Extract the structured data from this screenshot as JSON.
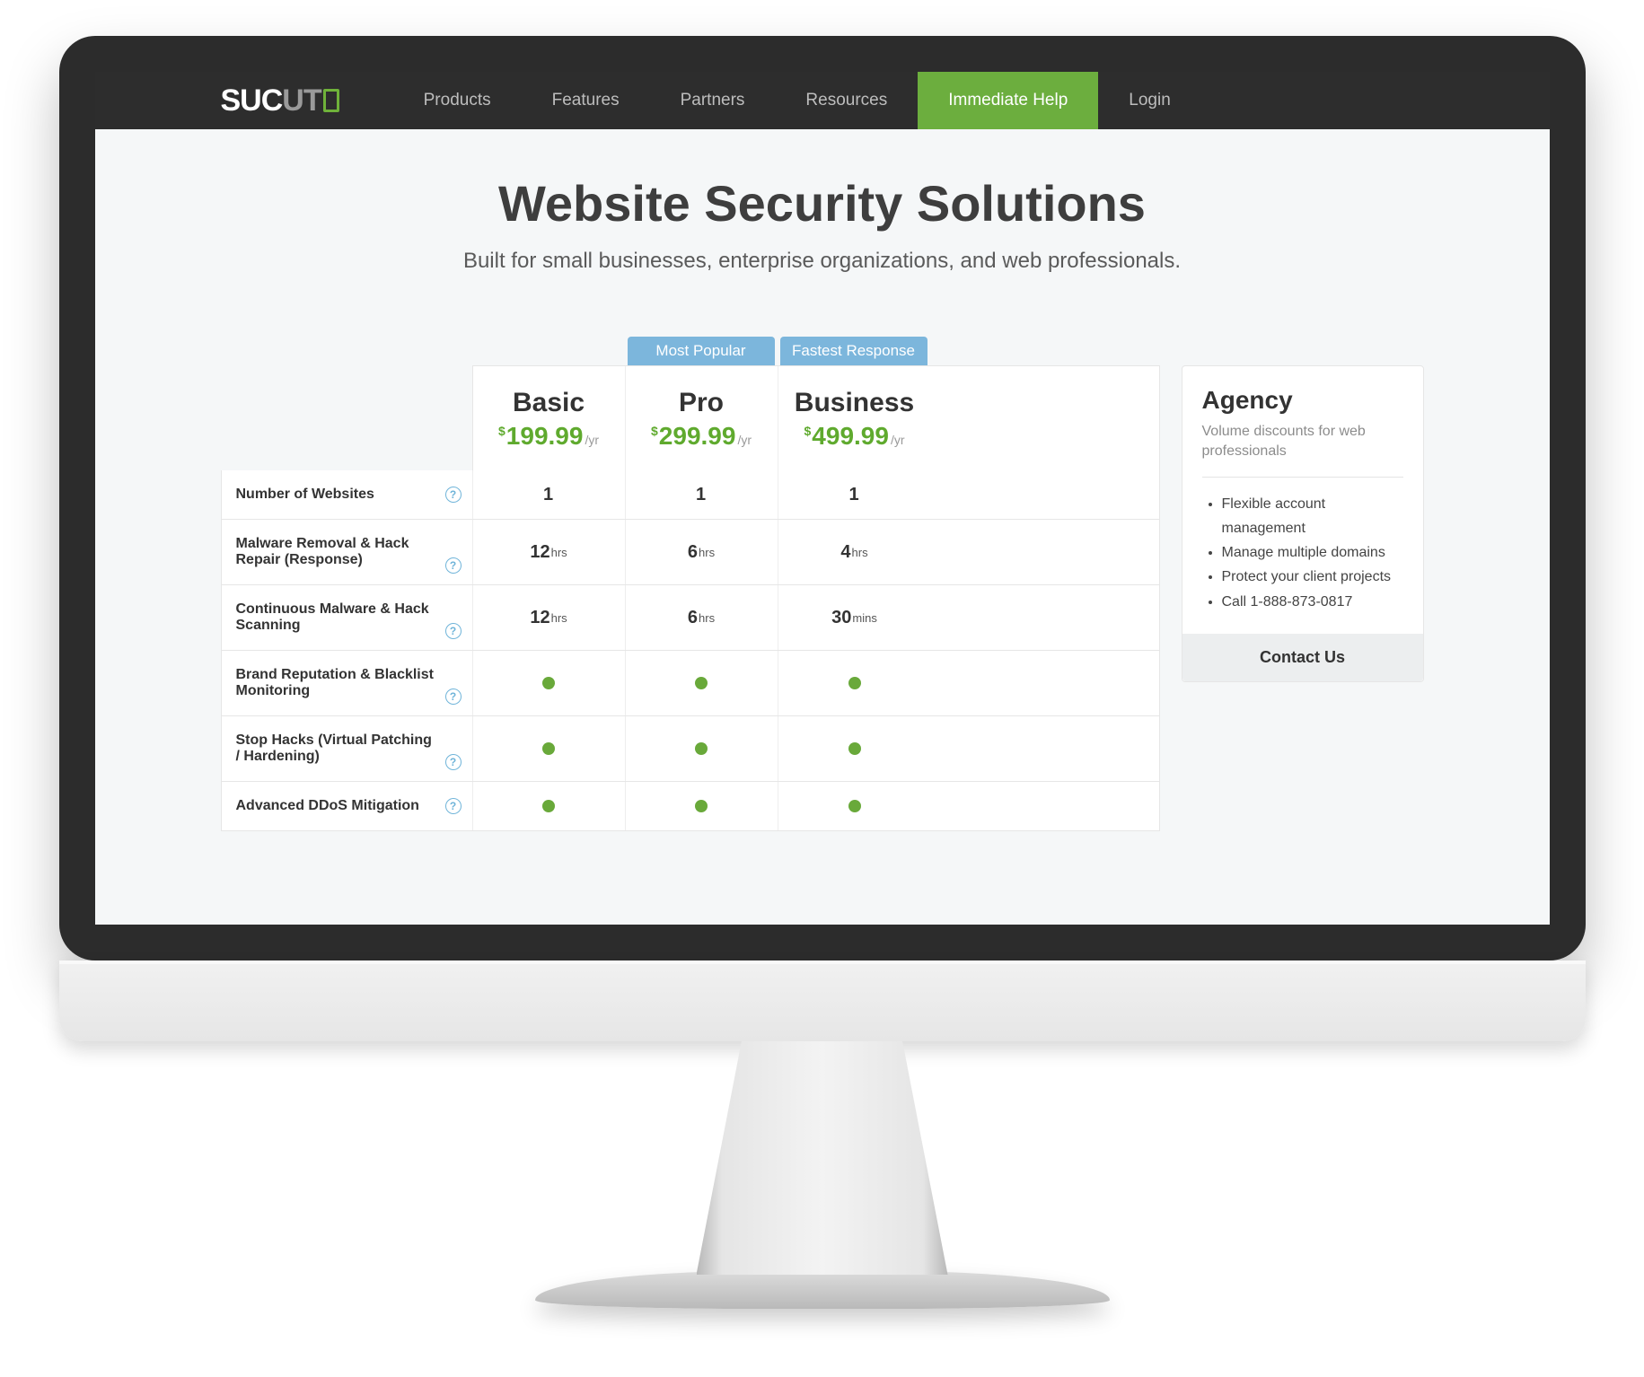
{
  "logo": {
    "p1": "SUC",
    "p2": "UT"
  },
  "nav": {
    "products": "Products",
    "features": "Features",
    "partners": "Partners",
    "resources": "Resources",
    "immediate_help": "Immediate Help",
    "login": "Login"
  },
  "page": {
    "title": "Website Security Solutions",
    "subtitle": "Built for small businesses, enterprise organizations, and web professionals."
  },
  "badges": {
    "pro": "Most Popular",
    "business": "Fastest Response"
  },
  "plans": {
    "basic": {
      "name": "Basic",
      "currency": "$",
      "price": "199.99",
      "period": "/yr"
    },
    "pro": {
      "name": "Pro",
      "currency": "$",
      "price": "299.99",
      "period": "/yr"
    },
    "business": {
      "name": "Business",
      "currency": "$",
      "price": "499.99",
      "period": "/yr"
    }
  },
  "features": [
    {
      "label": "Number of Websites",
      "type": "text",
      "basic": {
        "value": "1",
        "unit": ""
      },
      "pro": {
        "value": "1",
        "unit": ""
      },
      "business": {
        "value": "1",
        "unit": ""
      }
    },
    {
      "label": "Malware Removal & Hack Repair (Response)",
      "type": "text",
      "basic": {
        "value": "12",
        "unit": "hrs"
      },
      "pro": {
        "value": "6",
        "unit": "hrs"
      },
      "business": {
        "value": "4",
        "unit": "hrs"
      }
    },
    {
      "label": "Continuous Malware & Hack Scanning",
      "type": "text",
      "basic": {
        "value": "12",
        "unit": "hrs"
      },
      "pro": {
        "value": "6",
        "unit": "hrs"
      },
      "business": {
        "value": "30",
        "unit": "mins"
      }
    },
    {
      "label": "Brand Reputation & Blacklist Monitoring",
      "type": "dot"
    },
    {
      "label": "Stop Hacks (Virtual Patching / Hardening)",
      "type": "dot"
    },
    {
      "label": "Advanced DDoS Mitigation",
      "type": "dot"
    }
  ],
  "agency": {
    "title": "Agency",
    "subtitle": "Volume discounts for web professionals",
    "bullets": [
      "Flexible account management",
      "Manage multiple domains",
      "Protect your client projects",
      "Call 1-888-873-0817"
    ],
    "contact": "Contact Us"
  },
  "help_glyph": "?"
}
